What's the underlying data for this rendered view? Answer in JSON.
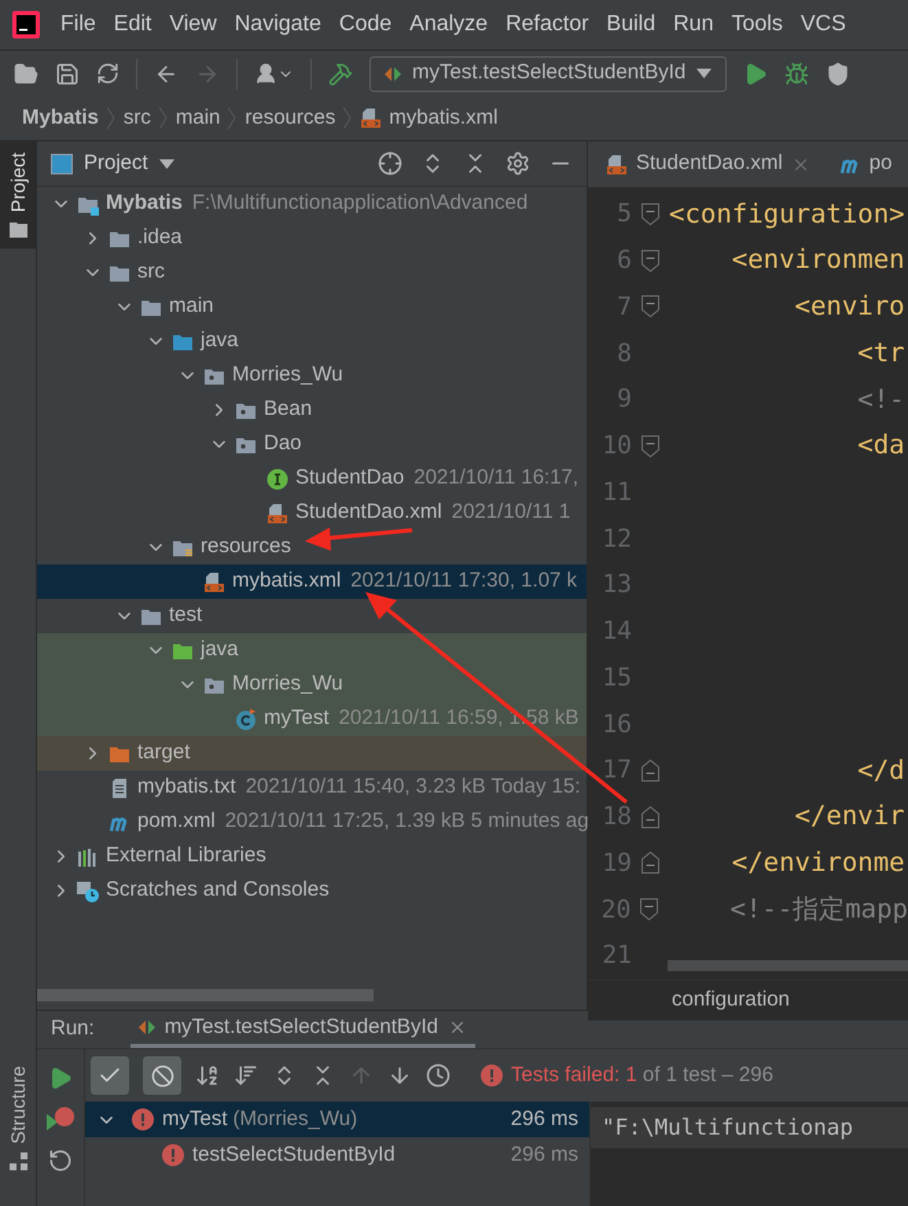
{
  "menu": [
    "File",
    "Edit",
    "View",
    "Navigate",
    "Code",
    "Analyze",
    "Refactor",
    "Build",
    "Run",
    "Tools",
    "VCS"
  ],
  "toolbar": {
    "run_config": "myTest.testSelectStudentById"
  },
  "breadcrumbs": [
    {
      "label": "Mybatis",
      "kind": "module"
    },
    {
      "label": "src",
      "kind": "folder"
    },
    {
      "label": "main",
      "kind": "folder"
    },
    {
      "label": "resources",
      "kind": "folder"
    },
    {
      "label": "mybatis.xml",
      "kind": "xml"
    }
  ],
  "side_tabs": [
    {
      "label": "Project",
      "selected": true,
      "kind": "top"
    },
    {
      "label": "Structure",
      "selected": false,
      "kind": "bottom"
    }
  ],
  "project_panel": {
    "title": "Project",
    "tree": [
      {
        "label": "Mybatis",
        "kind": "module",
        "detail": "F:\\Multifunctionapplication\\Advanced",
        "selected": false,
        "expanded": true,
        "children": [
          {
            "label": ".idea",
            "kind": "folder",
            "selected": false,
            "expanded": false
          },
          {
            "label": "src",
            "kind": "folder",
            "selected": false,
            "expanded": true,
            "children": [
              {
                "label": "main",
                "kind": "folder",
                "selected": false,
                "expanded": true,
                "children": [
                  {
                    "label": "java",
                    "kind": "java-folder",
                    "selected": false,
                    "expanded": true,
                    "children": [
                      {
                        "label": "Morries_Wu",
                        "kind": "package",
                        "selected": false,
                        "expanded": true,
                        "children": [
                          {
                            "label": "Bean",
                            "kind": "package",
                            "selected": false,
                            "expanded": false
                          },
                          {
                            "label": "Dao",
                            "kind": "package",
                            "selected": false,
                            "expanded": true,
                            "children": [
                              {
                                "label": "StudentDao",
                                "kind": "interface",
                                "detail": "2021/10/11 16:17,",
                                "selected": false
                              },
                              {
                                "label": "StudentDao.xml",
                                "kind": "xml",
                                "detail": "2021/10/11 1",
                                "selected": false
                              }
                            ]
                          }
                        ]
                      }
                    ]
                  },
                  {
                    "label": "resources",
                    "kind": "resources",
                    "selected": false,
                    "expanded": true,
                    "children": [
                      {
                        "label": "mybatis.xml",
                        "kind": "xml",
                        "detail": "2021/10/11 17:30, 1.07 k",
                        "selected": true
                      }
                    ]
                  }
                ]
              },
              {
                "label": "test",
                "kind": "folder",
                "selected": false,
                "expanded": true,
                "children": [
                  {
                    "label": "java",
                    "kind": "test-folder",
                    "selected": false,
                    "expanded": true,
                    "children": [
                      {
                        "label": "Morries_Wu",
                        "kind": "package",
                        "selected": false,
                        "expanded": true,
                        "children": [
                          {
                            "label": "myTest",
                            "kind": "class",
                            "detail": "2021/10/11 16:59, 1.58 kB",
                            "selected": false
                          }
                        ]
                      }
                    ]
                  }
                ]
              }
            ]
          },
          {
            "label": "target",
            "kind": "excluded-folder",
            "selected": false,
            "expanded": false
          },
          {
            "label": "mybatis.txt",
            "kind": "text",
            "detail": "2021/10/11 15:40, 3.23 kB Today 15:",
            "selected": false
          },
          {
            "label": "pom.xml",
            "kind": "maven",
            "detail": "2021/10/11 17:25, 1.39 kB 5 minutes ag",
            "selected": false
          }
        ]
      },
      {
        "label": "External Libraries",
        "kind": "libraries",
        "selected": false,
        "expanded": false
      },
      {
        "label": "Scratches and Consoles",
        "kind": "scratches",
        "selected": false,
        "expanded": false
      }
    ]
  },
  "editor": {
    "tabs": [
      {
        "label": "StudentDao.xml",
        "kind": "xml",
        "selected": false
      },
      {
        "label": "po",
        "kind": "maven",
        "selected": false
      }
    ],
    "lines": [
      {
        "number": "5",
        "text": "<configuration>",
        "kind": "tag",
        "fold_start": true
      },
      {
        "number": "6",
        "text": "    <environmen",
        "kind": "tag",
        "fold_start": true
      },
      {
        "number": "7",
        "text": "        <enviro",
        "kind": "tag",
        "fold_start": true
      },
      {
        "number": "8",
        "text": "            <tr",
        "kind": "tag"
      },
      {
        "number": "9",
        "text": "            <!-",
        "kind": "comment"
      },
      {
        "number": "10",
        "text": "            <da",
        "kind": "tag",
        "fold_start": true
      },
      {
        "number": "11"
      },
      {
        "number": "12"
      },
      {
        "number": "13"
      },
      {
        "number": "14"
      },
      {
        "number": "15"
      },
      {
        "number": "16"
      },
      {
        "number": "17",
        "text": "            </d",
        "kind": "tag",
        "fold_end": true
      },
      {
        "number": "18",
        "text": "        </envir",
        "kind": "tag",
        "fold_end": true
      },
      {
        "number": "19",
        "text": "    </environme",
        "kind": "tag",
        "fold_end": true
      },
      {
        "number": "20",
        "text": "    <!--指定mapp",
        "kind": "comment",
        "fold_start": true
      },
      {
        "number": "21"
      }
    ],
    "breadcrumb": "configuration"
  },
  "run_panel": {
    "label": "Run:",
    "tab": {
      "label": "myTest.testSelectStudentById",
      "selected": true
    },
    "toggles": [
      {
        "kind": "passed",
        "on": true
      },
      {
        "kind": "ignored",
        "on": true
      }
    ],
    "status": {
      "failed": "Tests failed: 1",
      "rest": "of 1 test – 296"
    },
    "results": [
      {
        "name": "myTest",
        "detail": "(Morries_Wu)",
        "time": "296 ms",
        "failed": true,
        "selected": true,
        "expanded": true,
        "children": [
          {
            "name": "testSelectStudentById",
            "time": "296 ms",
            "failed": true,
            "selected": false
          }
        ]
      }
    ],
    "console": [
      "\"F:\\Multifunctionap"
    ]
  }
}
